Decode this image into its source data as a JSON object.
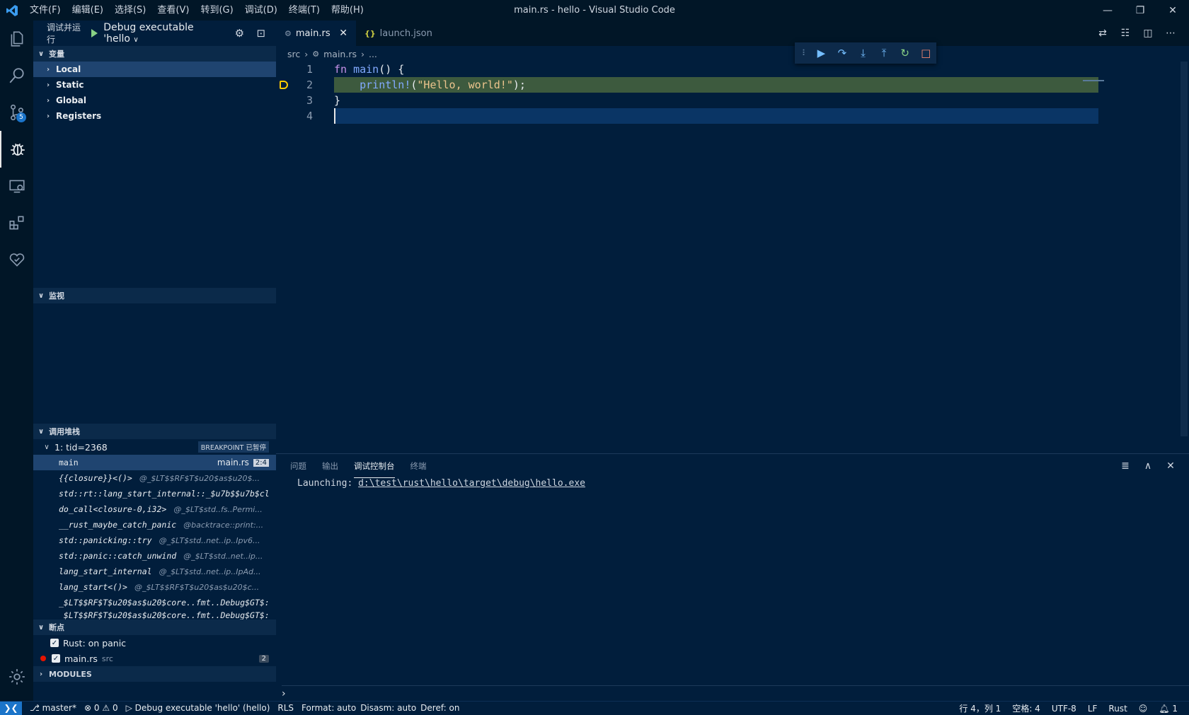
{
  "window": {
    "title": "main.rs - hello - Visual Studio Code",
    "menu": [
      "文件(F)",
      "编辑(E)",
      "选择(S)",
      "查看(V)",
      "转到(G)",
      "调试(D)",
      "终端(T)",
      "帮助(H)"
    ]
  },
  "activity": {
    "scm_badge": "5"
  },
  "sidebar": {
    "run_label": "调试并运行",
    "config_name": "Debug executable 'hello",
    "variables": {
      "title": "变量",
      "items": [
        "Local",
        "Static",
        "Global",
        "Registers"
      ]
    },
    "watch": {
      "title": "监视"
    },
    "callstack": {
      "title": "调用堆栈",
      "thread": "1: tid=2368",
      "paused_label": "BREAKPOINT 已暂停",
      "frames": [
        {
          "name": "main",
          "source": "",
          "file": "main.rs",
          "pos": "2:4"
        },
        {
          "name": "{{closure}}<()>",
          "source": "@_$LT$$RF$T$u20$as$u20$..."
        },
        {
          "name": "std::rt::lang_start_internal::_$u7b$$u7b$cl",
          "source": ""
        },
        {
          "name": "do_call<closure-0,i32>",
          "source": "@_$LT$std..fs..Permi..."
        },
        {
          "name": "__rust_maybe_catch_panic",
          "source": "@backtrace::print:..."
        },
        {
          "name": "std::panicking::try",
          "source": "@_$LT$std..net..ip..Ipv6..."
        },
        {
          "name": "std::panic::catch_unwind",
          "source": "@_$LT$std..net..ip..."
        },
        {
          "name": "lang_start_internal",
          "source": "@_$LT$std..net..ip..IpAd..."
        },
        {
          "name": "lang_start<()>",
          "source": "@_$LT$$RF$T$u20$as$u20$c..."
        },
        {
          "name": "_$LT$$RF$T$u20$as$u20$core..fmt..Debug$GT$:",
          "source": ""
        },
        {
          "name": "_$LT$$RF$T$u20$as$u20$core..fmt..Debug$GT$:",
          "source": ""
        }
      ]
    },
    "breakpoints": {
      "title": "断点",
      "items": [
        {
          "label": "Rust: on panic",
          "src": "",
          "count": ""
        },
        {
          "label": "main.rs",
          "src": "src",
          "count": "2"
        }
      ]
    },
    "modules": {
      "title": "MODULES"
    }
  },
  "editor": {
    "tabs": [
      {
        "label": "main.rs",
        "active": true
      },
      {
        "label": "launch.json",
        "active": false
      }
    ],
    "breadcrumb": [
      "src",
      "main.rs",
      "..."
    ],
    "lines": [
      {
        "num": "1"
      },
      {
        "num": "2"
      },
      {
        "num": "3"
      },
      {
        "num": "4"
      }
    ],
    "code": {
      "l1_kw": "fn",
      "l1_fn": " main",
      "l1_rest": "() {",
      "l2_macro": "    println!",
      "l2_open": "(",
      "l2_str": "\"Hello, world!\"",
      "l2_close": ");",
      "l3": "}"
    }
  },
  "panel": {
    "tabs": [
      "问题",
      "输出",
      "调试控制台",
      "终端"
    ],
    "active_tab": "调试控制台",
    "console_prefix": "Launching: ",
    "console_path": "d:\\test\\rust\\hello\\target\\debug\\hello.exe"
  },
  "statusbar": {
    "branch": "master*",
    "errors": "0",
    "warnings": "0",
    "debug_config": "Debug executable 'hello' (hello)",
    "rls": "RLS",
    "format": "Format: auto",
    "disasm": "Disasm: auto",
    "deref": "Deref: on",
    "position": "行 4，列 1",
    "spaces": "空格: 4",
    "encoding": "UTF-8",
    "eol": "LF",
    "language": "Rust",
    "notifications": "1"
  }
}
